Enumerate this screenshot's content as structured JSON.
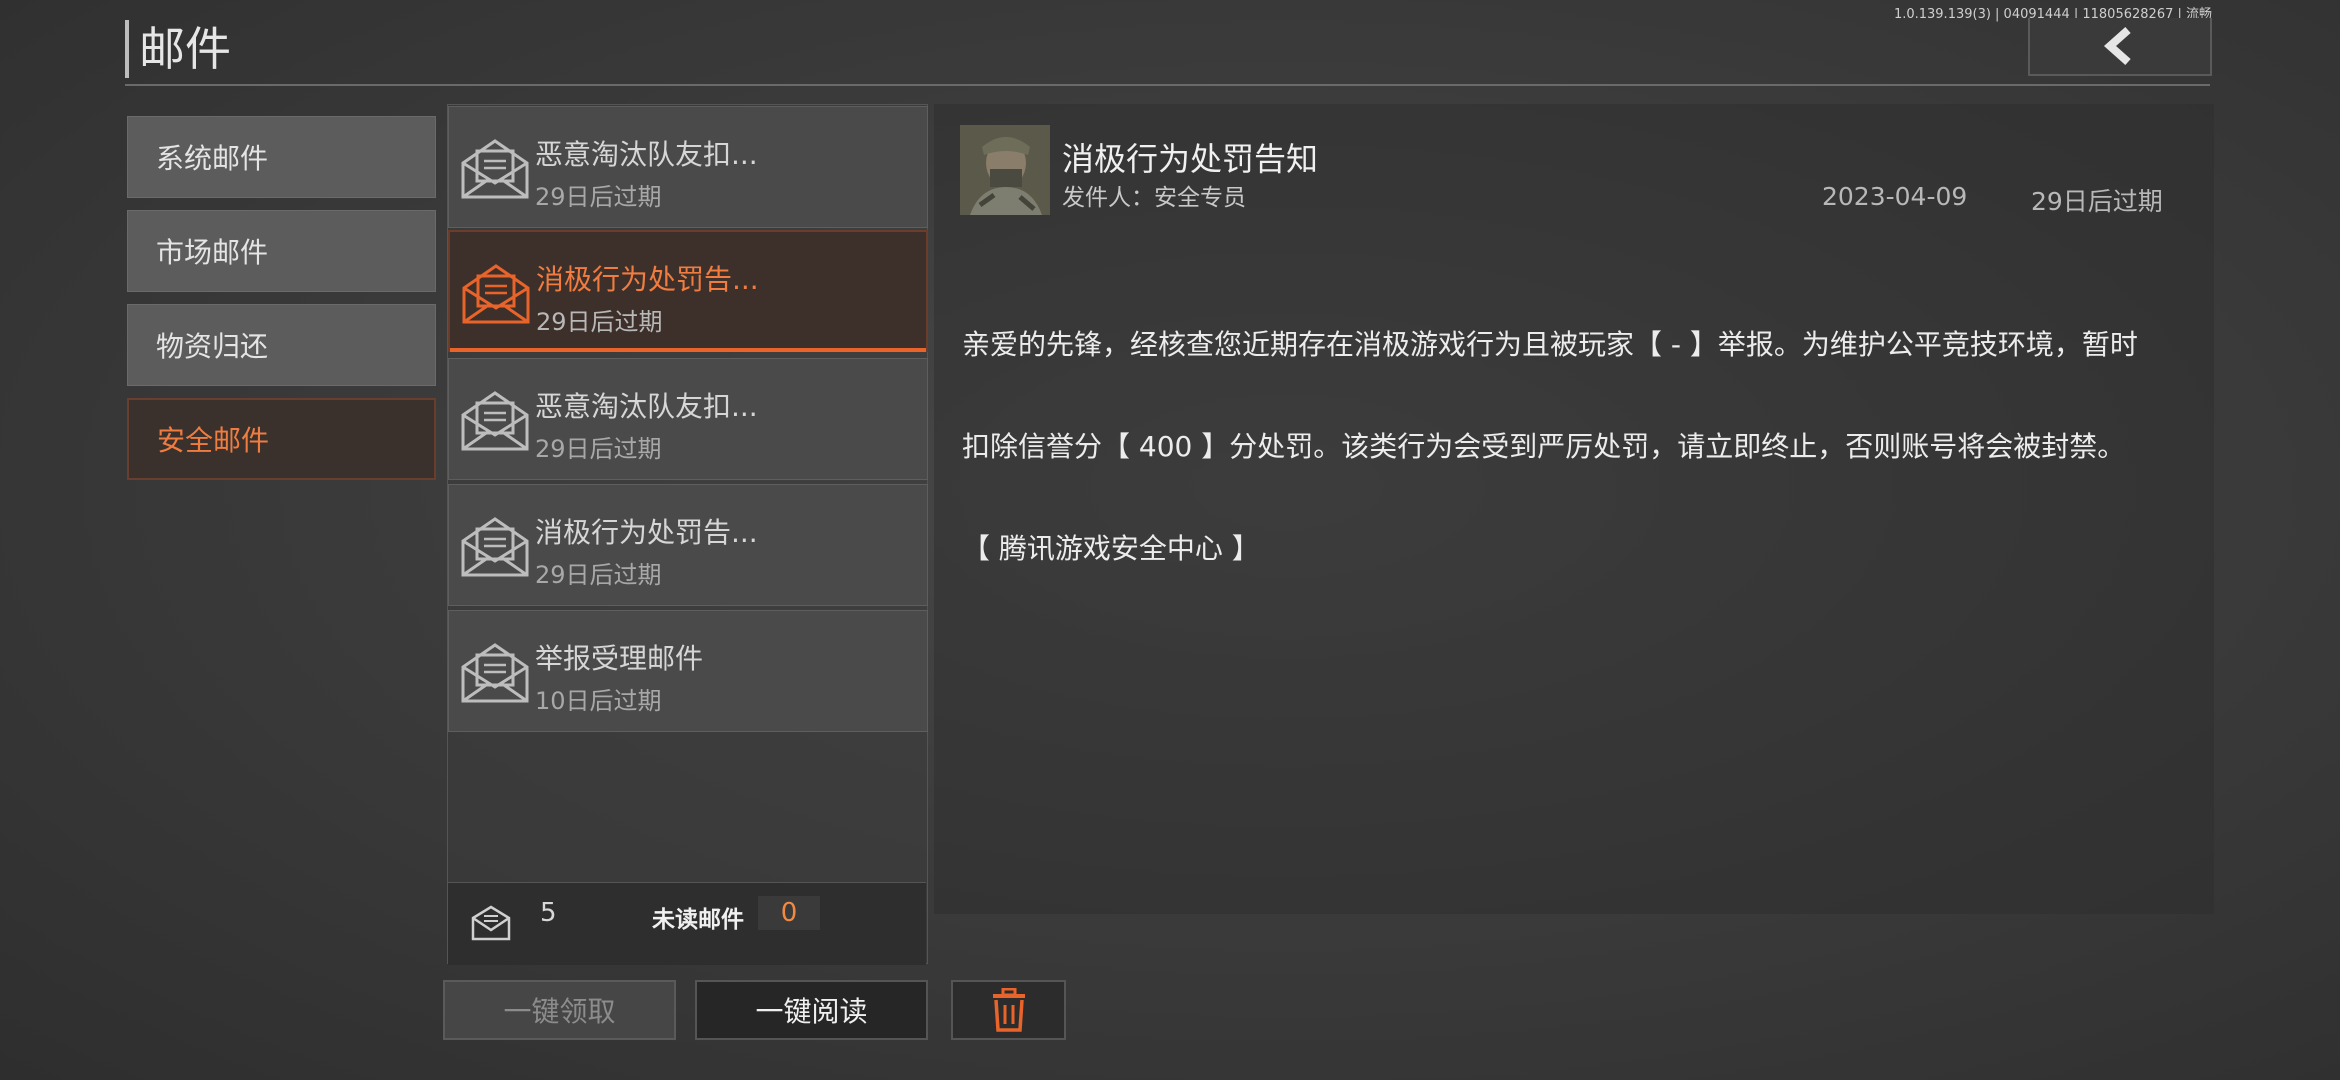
{
  "header": {
    "title": "邮件",
    "version": "1.0.139.139(3) | 04091444 | 11805628267 | 流畅"
  },
  "categories": [
    {
      "label": "系统邮件",
      "active": false
    },
    {
      "label": "市场邮件",
      "active": false
    },
    {
      "label": "物资归还",
      "active": false
    },
    {
      "label": "安全邮件",
      "active": true
    }
  ],
  "mails": [
    {
      "subject": "恶意淘汰队友扣...",
      "expire": "29日后过期",
      "active": false
    },
    {
      "subject": "消极行为处罚告...",
      "expire": "29日后过期",
      "active": true
    },
    {
      "subject": "恶意淘汰队友扣...",
      "expire": "29日后过期",
      "active": false
    },
    {
      "subject": "消极行为处罚告...",
      "expire": "29日后过期",
      "active": false
    },
    {
      "subject": "举报受理邮件",
      "expire": "10日后过期",
      "active": false
    }
  ],
  "footer": {
    "total_count": "5",
    "unread_label": "未读邮件",
    "unread_count": "0"
  },
  "buttons": {
    "claim_all": "一键领取",
    "read_all": "一键阅读"
  },
  "detail": {
    "title": "消极行为处罚告知",
    "sender": "发件人：安全专员",
    "date": "2023-04-09",
    "expire": "29日后过期",
    "body_line1": "亲爱的先锋，经核查您近期存在消极游戏行为且被玩家【 - 】举报。为维护公平竞技环境，暂时",
    "body_line2": "扣除信誉分【 400 】分处罚。该类行为会受到严厉处罚，请立即终止，否则账号将会被封禁。",
    "body_line3": "【 腾讯游戏安全中心 】"
  },
  "colors": {
    "accent": "#f07c40",
    "active_bg": "#3a312d"
  }
}
